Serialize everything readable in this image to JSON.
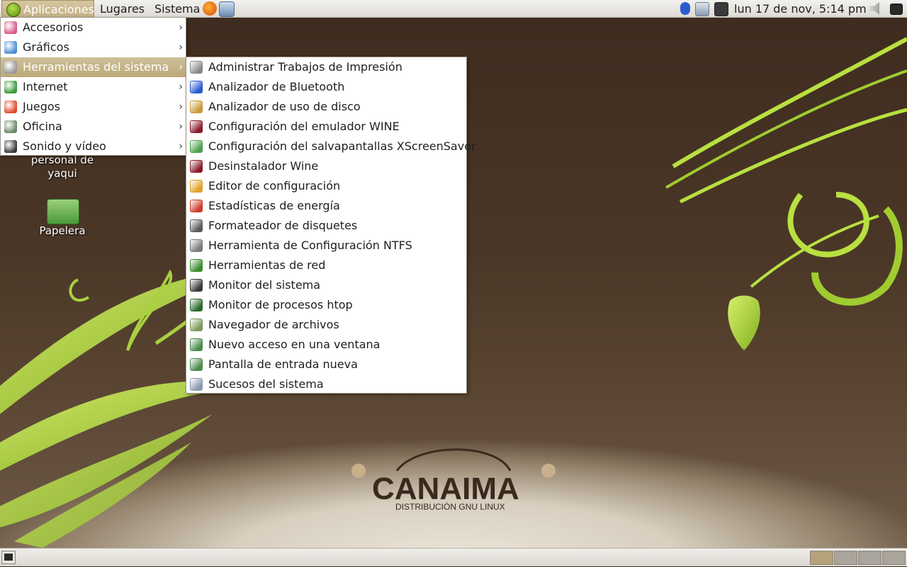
{
  "top_panel": {
    "menus": [
      "Aplicaciones",
      "Lugares",
      "Sistema"
    ],
    "launchers": [
      "firefox-icon",
      "mail-client-icon"
    ],
    "tray_icons": [
      "bluetooth-icon",
      "network-manager-icon",
      "printer-error-icon"
    ],
    "clock": "lun 17 de nov,  5:14 pm",
    "volume_icon": "volume-icon",
    "show_desktop_icon": "show-desktop-icon"
  },
  "desktop": {
    "icons": [
      {
        "label": "personal de\nyaqui",
        "icon": "home-folder-icon"
      },
      {
        "label": "Papelera",
        "icon": "trash-icon"
      }
    ],
    "wallpaper_text": {
      "brand": "CANAIMA",
      "tagline": "DISTRIBUCIÓN GNU LINUX"
    }
  },
  "applications_menu": {
    "items": [
      {
        "label": "Accesorios",
        "icon": "accessories-icon",
        "icon_color": "#d85a8a"
      },
      {
        "label": "Gráficos",
        "icon": "graphics-icon",
        "icon_color": "#4a8fd0"
      },
      {
        "label": "Herramientas del sistema",
        "icon": "system-tools-icon",
        "icon_color": "#9a9a9a",
        "active": true
      },
      {
        "label": "Internet",
        "icon": "internet-icon",
        "icon_color": "#3a9a3a"
      },
      {
        "label": "Juegos",
        "icon": "games-icon",
        "icon_color": "#e04a2a"
      },
      {
        "label": "Oficina",
        "icon": "office-icon",
        "icon_color": "#6a8a6a"
      },
      {
        "label": "Sonido y vídeo",
        "icon": "sound-video-icon",
        "icon_color": "#3a3a3a"
      }
    ]
  },
  "system_tools_submenu": {
    "items": [
      {
        "label": "Administrar Trabajos de Impresión",
        "icon": "printer-icon",
        "icon_color": "#8a8a8a"
      },
      {
        "label": "Analizador de Bluetooth",
        "icon": "bluetooth-icon",
        "icon_color": "#2a5ad0"
      },
      {
        "label": "Analizador de uso de disco",
        "icon": "disk-usage-icon",
        "icon_color": "#c89a3a"
      },
      {
        "label": "Configuración del emulador WINE",
        "icon": "wine-glass-icon",
        "icon_color": "#8a1a2a"
      },
      {
        "label": "Configuración del salvapantallas XScreenSaver",
        "icon": "screensaver-icon",
        "icon_color": "#4aa04a"
      },
      {
        "label": "Desinstalador Wine",
        "icon": "wine-glass-icon",
        "icon_color": "#8a1a2a"
      },
      {
        "label": "Editor de configuración",
        "icon": "config-editor-icon",
        "icon_color": "#e0a02a"
      },
      {
        "label": "Estadísticas de energía",
        "icon": "power-stats-icon",
        "icon_color": "#d03a2a"
      },
      {
        "label": "Formateador de disquetes",
        "icon": "floppy-icon",
        "icon_color": "#5a5a5a"
      },
      {
        "label": "Herramienta de Configuración NTFS",
        "icon": "ntfs-icon",
        "icon_color": "#7a7a7a"
      },
      {
        "label": "Herramientas de red",
        "icon": "network-tools-icon",
        "icon_color": "#3a8a2a"
      },
      {
        "label": "Monitor del sistema",
        "icon": "system-monitor-icon",
        "icon_color": "#3a3a3a"
      },
      {
        "label": "Monitor de procesos htop",
        "icon": "htop-icon",
        "icon_color": "#2a6a2a"
      },
      {
        "label": "Navegador de archivos",
        "icon": "file-browser-icon",
        "icon_color": "#7a9a5a"
      },
      {
        "label": "Nuevo acceso en una ventana",
        "icon": "new-login-window-icon",
        "icon_color": "#4a8a4a"
      },
      {
        "label": "Pantalla de entrada nueva",
        "icon": "new-login-screen-icon",
        "icon_color": "#4a8a4a"
      },
      {
        "label": "Sucesos del sistema",
        "icon": "system-log-icon",
        "icon_color": "#8a9ab0"
      }
    ]
  },
  "bottom_panel": {
    "show_desktop_icon": "show-desktop-icon",
    "workspaces": 4,
    "active_workspace": 1
  }
}
